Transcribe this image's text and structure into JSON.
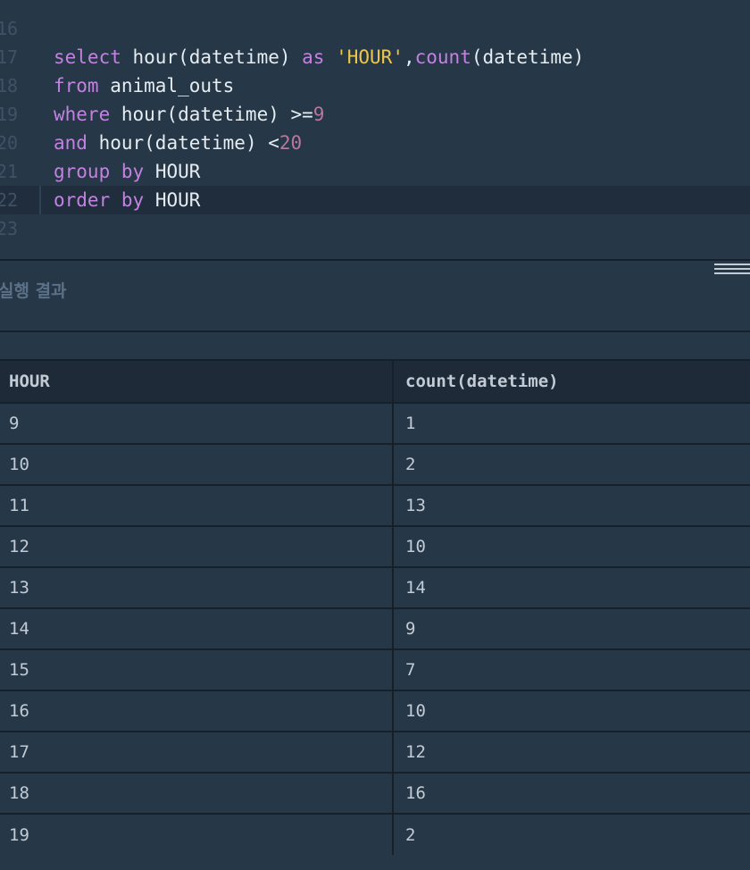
{
  "editor": {
    "lines": [
      {
        "num": "16",
        "tokens": []
      },
      {
        "num": "17",
        "tokens": [
          {
            "t": "select",
            "c": "kw"
          },
          {
            "t": " hour(datetime) ",
            "c": ""
          },
          {
            "t": "as",
            "c": "kw"
          },
          {
            "t": " ",
            "c": ""
          },
          {
            "t": "'HOUR'",
            "c": "str"
          },
          {
            "t": ",",
            "c": ""
          },
          {
            "t": "count",
            "c": "fn"
          },
          {
            "t": "(datetime)",
            "c": ""
          }
        ]
      },
      {
        "num": "18",
        "tokens": [
          {
            "t": "from",
            "c": "kw"
          },
          {
            "t": " animal_outs",
            "c": ""
          }
        ]
      },
      {
        "num": "19",
        "tokens": [
          {
            "t": "where",
            "c": "kw"
          },
          {
            "t": " hour(datetime) >=",
            "c": ""
          },
          {
            "t": "9",
            "c": "num"
          }
        ]
      },
      {
        "num": "20",
        "tokens": [
          {
            "t": "and",
            "c": "kw"
          },
          {
            "t": " hour(datetime) <",
            "c": ""
          },
          {
            "t": "20",
            "c": "num"
          }
        ]
      },
      {
        "num": "21",
        "tokens": [
          {
            "t": "group",
            "c": "kw"
          },
          {
            "t": " ",
            "c": ""
          },
          {
            "t": "by",
            "c": "kw"
          },
          {
            "t": " HOUR",
            "c": ""
          }
        ]
      },
      {
        "num": "22",
        "active": true,
        "tokens": [
          {
            "t": "order",
            "c": "kw"
          },
          {
            "t": " ",
            "c": ""
          },
          {
            "t": "by",
            "c": "kw"
          },
          {
            "t": " HOUR",
            "c": ""
          }
        ]
      },
      {
        "num": "23",
        "tokens": []
      }
    ]
  },
  "results": {
    "title": "실행 결과",
    "columns": [
      "HOUR",
      "count(datetime)"
    ],
    "rows": [
      [
        "9",
        "1"
      ],
      [
        "10",
        "2"
      ],
      [
        "11",
        "13"
      ],
      [
        "12",
        "10"
      ],
      [
        "13",
        "14"
      ],
      [
        "14",
        "9"
      ],
      [
        "15",
        "7"
      ],
      [
        "16",
        "10"
      ],
      [
        "17",
        "12"
      ],
      [
        "18",
        "16"
      ],
      [
        "19",
        "2"
      ]
    ]
  },
  "colors": {
    "background": "#263747",
    "keyword": "#c382e0",
    "string": "#ecc74c",
    "number": "#b7789e",
    "text": "#e5ecf2"
  }
}
